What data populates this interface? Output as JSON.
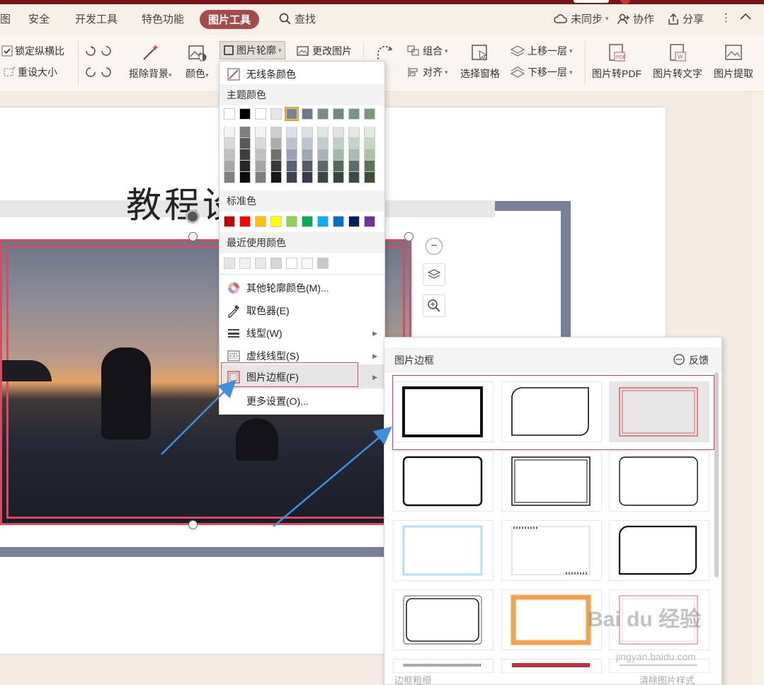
{
  "tabs": {
    "partial": "图",
    "security": "安全",
    "devtools": "开发工具",
    "special": "特色功能",
    "picture_tools": "图片工具",
    "search": "查找"
  },
  "topright": {
    "sync": "未同步",
    "collab": "协作",
    "share": "分享"
  },
  "ribbon": {
    "lock_ratio": "锁定纵横比",
    "reset_size": "重设大小",
    "remove_bg": "抠除背景",
    "color": "颜色",
    "outline": "图片轮廓",
    "change_picture": "更改图片",
    "rotate": "转",
    "group": "组合",
    "align": "对齐",
    "selection_pane": "选择窗格",
    "bring_forward": "上移一层",
    "send_backward": "下移一层",
    "to_pdf": "图片转PDF",
    "to_text": "图片转文字",
    "extract": "图片提取"
  },
  "slide": {
    "title": "教程设"
  },
  "menu": {
    "no_line": "无线条颜色",
    "theme_colors": "主题颜色",
    "standard_colors": "标准色",
    "recent_colors": "最近使用颜色",
    "more_colors": "其他轮廓颜色(M)...",
    "eyedropper": "取色器(E)",
    "line_style": "线型(W)",
    "dash_style": "虚线线型(S)",
    "picture_border": "图片边框(F)",
    "more_settings": "更多设置(O)..."
  },
  "theme_top_row": [
    "#ffffff",
    "#000000",
    "#ffffff",
    "#e7e6e6",
    "#7b819b",
    "#6e7a8c",
    "#7d8a8c",
    "#6f8a7c",
    "#78948a",
    "#7a9a78"
  ],
  "theme_shades": [
    [
      "#f2f2f2",
      "#7f7f7f",
      "#f2f2f2",
      "#d0cece",
      "#dde0e8",
      "#dde1e6",
      "#e0e5e5",
      "#dfe6e2",
      "#e1e8e5",
      "#e2eae0"
    ],
    [
      "#d8d8d8",
      "#595959",
      "#d8d8d8",
      "#aeabab",
      "#bcc1d0",
      "#bdc4ce",
      "#c3ccce",
      "#c0cfc6",
      "#c4d2cc",
      "#c6d6c1"
    ],
    [
      "#bfbfbf",
      "#3f3f3f",
      "#bfbfbf",
      "#757070",
      "#9aa1b8",
      "#9ea7b5",
      "#a6b2b5",
      "#a1b8aa",
      "#a6bcb2",
      "#aac1a2"
    ],
    [
      "#a5a5a5",
      "#262626",
      "#a5a5a5",
      "#3a3838",
      "#5b6178",
      "#525c6a",
      "#5d6869",
      "#536a5c",
      "#5a6e66",
      "#5b7357"
    ],
    [
      "#7f7f7f",
      "#0c0c0c",
      "#7f7f7f",
      "#171616",
      "#3d4150",
      "#373d47",
      "#3e4546",
      "#37463d",
      "#3c4944",
      "#3d4d3a"
    ]
  ],
  "standard_colors_list": [
    "#c00000",
    "#ff0000",
    "#ffc000",
    "#ffff00",
    "#92d050",
    "#00b050",
    "#00b0f0",
    "#0070c0",
    "#002060",
    "#7030a0"
  ],
  "recent_colors_list": [
    "#e5e5e5",
    "#f0f0f0",
    "#e9e9e9",
    "#d6d6d6",
    "#ffffff",
    "#f7f7f7",
    "#c8c8c8"
  ],
  "panel": {
    "title": "图片边框",
    "feedback": "反馈",
    "footer_left": "边框粗细",
    "footer_right": "清除图片样式"
  },
  "watermark": {
    "text": "Bai du 经验",
    "sub": "jingyan.baidu.com"
  }
}
